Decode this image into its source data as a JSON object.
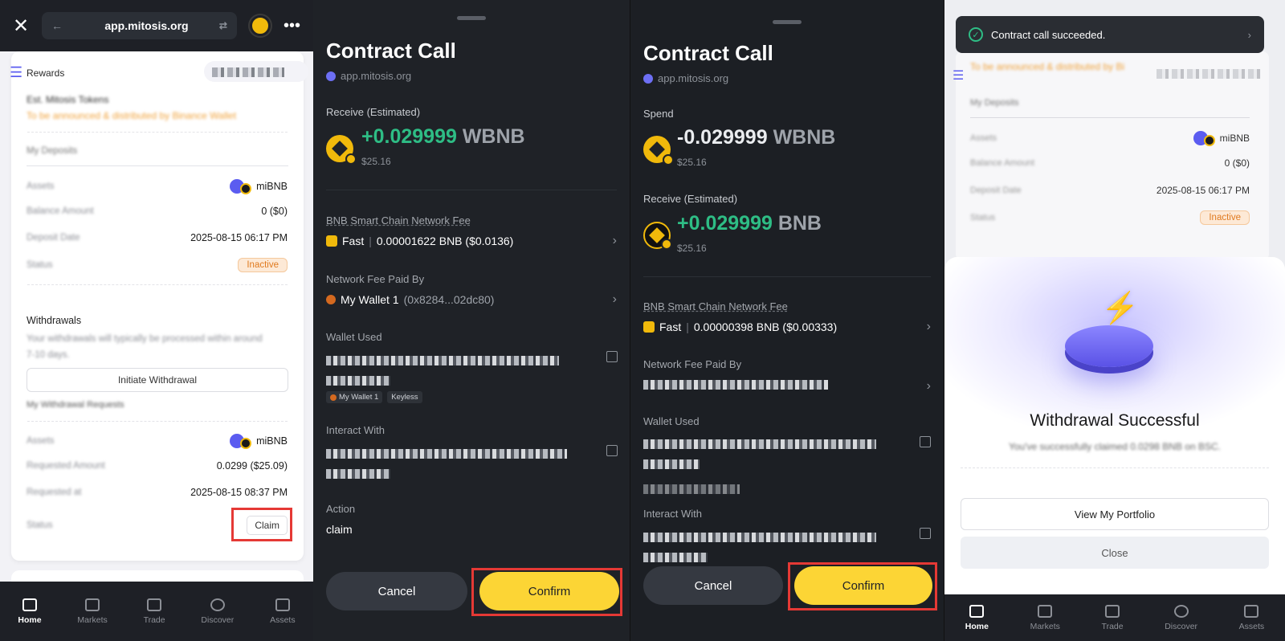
{
  "panel1": {
    "url": "app.mitosis.org",
    "header": "Rewards",
    "est_tokens_label": "Est. Mitosis Tokens",
    "est_tokens_note": "To be announced & distributed by Binance Wallet",
    "deposits_title": "My Deposits",
    "deposits": [
      {
        "label": "Assets",
        "value": "miBNB"
      },
      {
        "label": "Balance Amount",
        "value": "0 ($0)"
      },
      {
        "label": "Deposit Date",
        "value": "2025-08-15 06:17 PM"
      },
      {
        "label": "Status",
        "value": "Inactive"
      }
    ],
    "withdrawals_title": "Withdrawals",
    "withdrawals_desc": "Your withdrawals will typically be processed within around 7-10 days.",
    "initiate_button": "Initiate Withdrawal",
    "requests_title": "My Withdrawal Requests",
    "requests": [
      {
        "label": "Assets",
        "value": "miBNB"
      },
      {
        "label": "Requested Amount",
        "value": "0.0299 ($25.09)"
      },
      {
        "label": "Requested at",
        "value": "2025-08-15 08:37 PM"
      },
      {
        "label": "Status",
        "value": "Claim"
      }
    ]
  },
  "nav": [
    "Home",
    "Markets",
    "Trade",
    "Discover",
    "Assets"
  ],
  "panel2": {
    "title": "Contract Call",
    "site": "app.mitosis.org",
    "receive_label": "Receive (Estimated)",
    "receive_amount": "+0.029999",
    "receive_token": "WBNB",
    "receive_usd": "$25.16",
    "fee_label": "BNB Smart Chain Network Fee",
    "fee_speed": "Fast",
    "fee_value": "0.00001622 BNB ($0.0136)",
    "paid_by_label": "Network Fee Paid By",
    "paid_by_wallet": "My Wallet 1",
    "paid_by_addr": "(0x8284...02dc80)",
    "wallet_used_label": "Wallet Used",
    "tag_wallet": "My Wallet 1",
    "tag_keyless": "Keyless",
    "interact_label": "Interact With",
    "action_label": "Action",
    "action_value": "claim",
    "cancel": "Cancel",
    "confirm": "Confirm"
  },
  "panel3": {
    "title": "Contract Call",
    "site": "app.mitosis.org",
    "spend_label": "Spend",
    "spend_amount": "-0.029999",
    "spend_token": "WBNB",
    "spend_usd": "$25.16",
    "receive_label": "Receive (Estimated)",
    "receive_amount": "+0.029999",
    "receive_token": "BNB",
    "receive_usd": "$25.16",
    "fee_label": "BNB Smart Chain Network Fee",
    "fee_speed": "Fast",
    "fee_value": "0.00000398 BNB ($0.00333)",
    "paid_by_label": "Network Fee Paid By",
    "wallet_used_label": "Wallet Used",
    "interact_label": "Interact With",
    "cancel": "Cancel",
    "confirm": "Confirm"
  },
  "panel4": {
    "toast": "Contract call succeeded.",
    "note": "To be announced & distributed by Bi",
    "deposits_title": "My Deposits",
    "deposits": [
      {
        "label": "Assets",
        "value": "miBNB"
      },
      {
        "label": "Balance Amount",
        "value": "0 ($0)"
      },
      {
        "label": "Deposit Date",
        "value": "2025-08-15 06:17 PM"
      },
      {
        "label": "Status",
        "value": "Inactive"
      }
    ],
    "success_title": "Withdrawal Successful",
    "success_desc": "You've successfully claimed 0.0298 BNB on BSC.",
    "portfolio_button": "View My Portfolio",
    "close_button": "Close"
  }
}
